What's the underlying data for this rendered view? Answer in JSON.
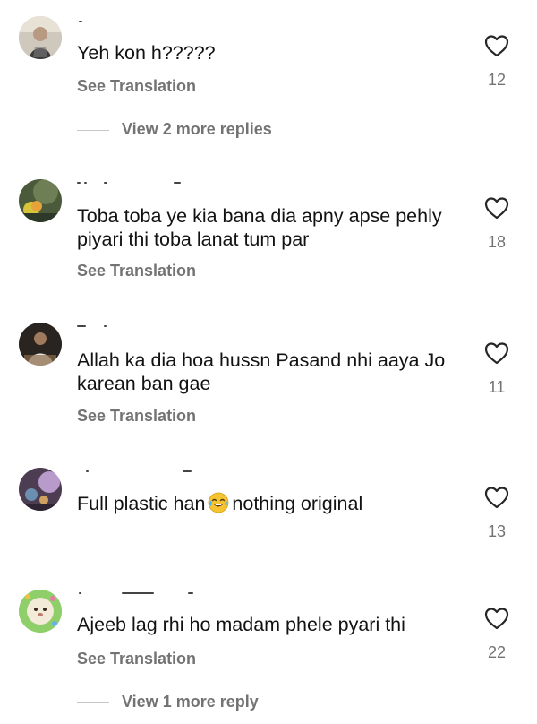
{
  "comments": [
    {
      "text": "Yeh kon h?????",
      "translation": "See Translation",
      "likes": "12",
      "replies": "View 2 more replies"
    },
    {
      "text": "Toba toba ye kia bana dia apny apse pehly piyari thi toba lanat tum par",
      "translation": "See Translation",
      "likes": "18"
    },
    {
      "text": "Allah ka dia hoa hussn Pasand nhi aaya Jo karean ban gae",
      "translation": "See Translation",
      "likes": "11"
    },
    {
      "text_before": "Full plastic han",
      "emoji": "face-with-tears-of-joy",
      "text_after": "nothing original",
      "likes": "13"
    },
    {
      "text": "Ajeeb lag rhi ho madam phele pyari thi",
      "translation": "See Translation",
      "likes": "22",
      "replies": "View 1 more reply"
    }
  ],
  "icons": {
    "like": "heart-outline-icon"
  },
  "colors": {
    "text": "#121212",
    "secondary": "#737373",
    "divider": "#c7c7c7"
  }
}
